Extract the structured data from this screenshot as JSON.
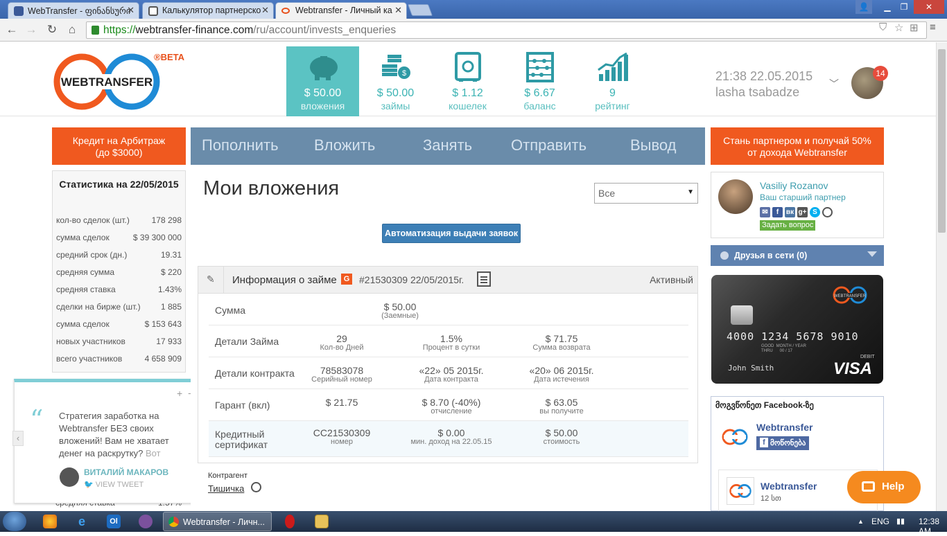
{
  "browser": {
    "tabs": [
      {
        "title": "WebTransfer - ფინანსური",
        "favicon_color": "#3b5998"
      },
      {
        "title": "Калькулятор партнерско",
        "favicon_color": "#555555"
      },
      {
        "title": "Webtransfer - Личный ка",
        "favicon_color": "#e8511c"
      }
    ],
    "url": {
      "scheme": "https://",
      "host": "webtransfer-finance.com",
      "path": "/ru/account/invests_enqueries"
    }
  },
  "header": {
    "logo_text": "WEBTRANSFER",
    "beta_label": "®BETA",
    "stats": [
      {
        "value": "$ 50.00",
        "label": "вложения",
        "icon": "piggy-bank-icon"
      },
      {
        "value": "$ 50.00",
        "label": "займы",
        "icon": "coins-icon"
      },
      {
        "value": "$ 1.12",
        "label": "кошелек",
        "icon": "safe-icon"
      },
      {
        "value": "$ 6.67",
        "label": "баланс",
        "icon": "abacus-icon"
      },
      {
        "value": "9",
        "label": "рейтинг",
        "icon": "chart-icon"
      }
    ],
    "datetime": "21:38 22.05.2015",
    "username": "lasha tsabadze",
    "notification_count": "14"
  },
  "credit_button": {
    "line1": "Кредит на Арбитраж",
    "line2": "(до $3000)"
  },
  "partner_button": {
    "line1": "Стань партнером и получай 50%",
    "line2": "от дохода Webtransfer"
  },
  "menu": [
    "Пополнить",
    "Вложить",
    "Занять",
    "Отправить",
    "Вывод"
  ],
  "stats": {
    "title": "Статистика на 22/05/2015",
    "rows": [
      {
        "label": "кол-во сделок (шт.)",
        "value": "178 298"
      },
      {
        "label": "сумма сделок",
        "value": "$ 39 300 000"
      },
      {
        "label": "средний срок (дн.)",
        "value": "19.31"
      },
      {
        "label": "средняя сумма",
        "value": "$ 220"
      },
      {
        "label": "средняя ставка",
        "value": "1.43%"
      },
      {
        "label": "сделки на бирже (шт.)",
        "value": "1 885"
      },
      {
        "label": "сумма сделок",
        "value": "$ 153 643"
      },
      {
        "label": "новых участников",
        "value": "17 933"
      },
      {
        "label": "всего участников",
        "value": "4 658 909"
      }
    ],
    "hidden_row": {
      "label": "средняя ставка",
      "value": "1.57%"
    }
  },
  "tweet": {
    "text": "Стратегия заработка на Webtransfer БЕЗ своих вложений! Вам не хватает денег на раскрутку?",
    "more": "Вот",
    "author": "ВИТАЛИЙ МАКАРОВ",
    "view": "VIEW TWEET"
  },
  "main": {
    "title": "Мои вложения",
    "filter": "Все",
    "auto_button": "Автоматизация выдачи заявок",
    "loan": {
      "header": "Информация о займе",
      "badge": "G",
      "number": "#21530309 22/05/2015г.",
      "status": "Активный",
      "rows": [
        {
          "label": "Сумма",
          "cells": [
            {
              "a": "$ 50.00",
              "b": "(Заемные)"
            }
          ]
        },
        {
          "label": "Детали Займа",
          "cells": [
            {
              "a": "29",
              "b": "Кол-во Дней"
            },
            {
              "a": "1.5%",
              "b": "Процент в сутки"
            },
            {
              "a": "$ 71.75",
              "b": "Сумма возврата"
            }
          ]
        },
        {
          "label": "Детали контракта",
          "cells": [
            {
              "a": "78583078",
              "b": "Серийный номер"
            },
            {
              "a": "«22» 05 2015г.",
              "b": "Дата контракта"
            },
            {
              "a": "«20» 06 2015г.",
              "b": "Дата истечения"
            }
          ]
        },
        {
          "label": "Гарант (вкл)",
          "cells": [
            {
              "a": "$ 21.75",
              "b": ""
            },
            {
              "a": "$ 8.70 (-40%)",
              "b": "отчисление"
            },
            {
              "a": "$ 63.05",
              "b": "вы получите"
            }
          ]
        },
        {
          "label1": "Кредитный",
          "label2": "сертификат",
          "cells": [
            {
              "a": "CC21530309",
              "b": "номер"
            },
            {
              "a": "$ 0.00",
              "b": "мин. доход на 22.05.15"
            },
            {
              "a": "$ 50.00",
              "b": "стоимость"
            }
          ]
        }
      ],
      "counterparty_label": "Контрагент",
      "counterparty_name": "Тишичка"
    }
  },
  "partner": {
    "name": "Vasiliy Rozanov",
    "role": "Ваш старший партнер",
    "ask_button": "Задать вопрос"
  },
  "friends": {
    "label": "Друзья в сети (0)"
  },
  "card": {
    "number": "4000 1234 5678 9010",
    "holder": "John Smith",
    "good_thru": "GOOD  MONTH / YEAR\nTHRU      00 / 17",
    "type": "DEBIT",
    "brand": "VISA",
    "logo_text": "WEBTRANSFER"
  },
  "facebook": {
    "header": "მოგვწონეთ Facebook-ზე",
    "page_name": "Webtransfer",
    "like_label": "მოწონება",
    "post_name": "Webtransfer",
    "post_time": "12 სთ"
  },
  "help_button": "Help",
  "taskbar": {
    "chrome_label": "Webtransfer - Личн...",
    "lang": "ENG",
    "time": "12:38 AM"
  }
}
